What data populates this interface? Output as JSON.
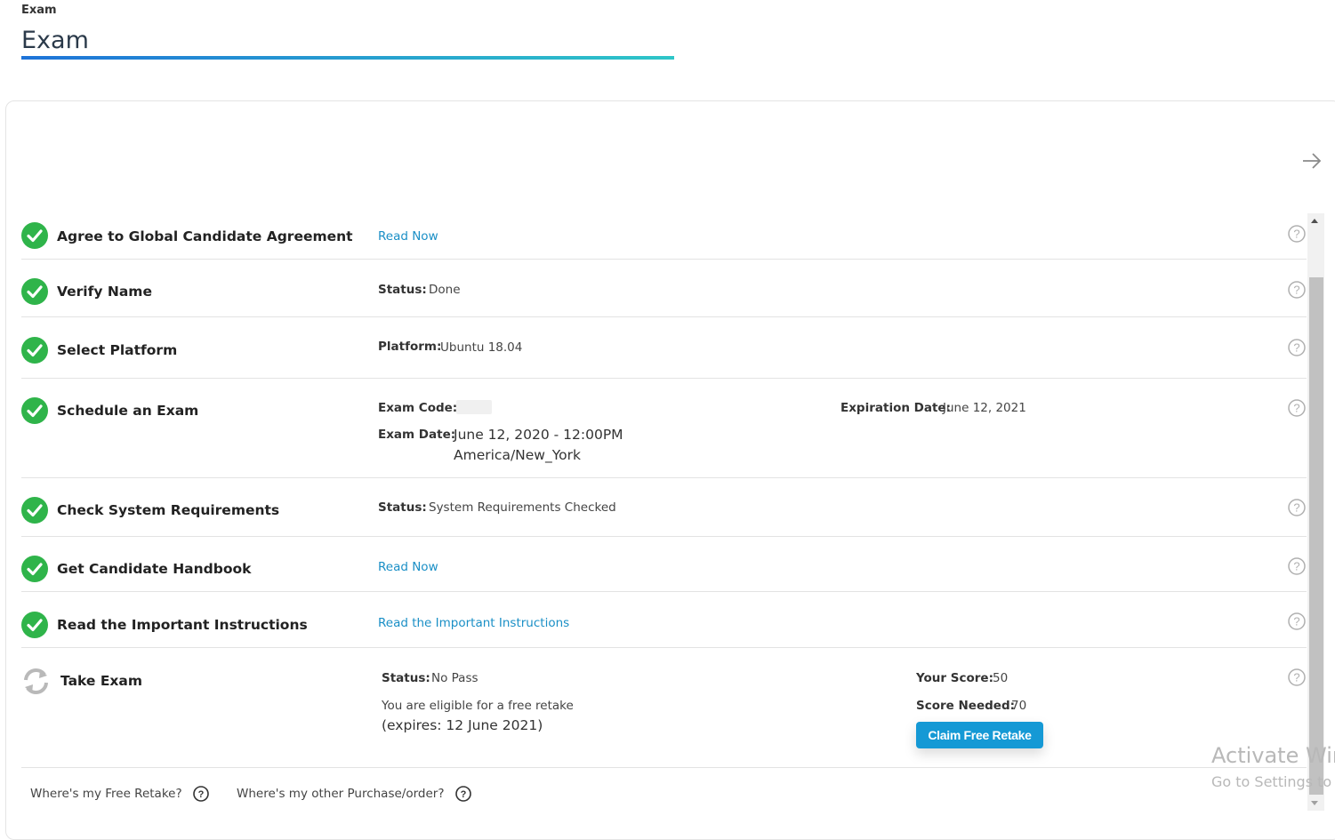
{
  "header": {
    "breadcrumb": "Exam",
    "title": "Exam"
  },
  "colors": {
    "accent": "#1a8fc6",
    "check": "#2fb44a",
    "button": "#1599d5"
  },
  "steps": {
    "agreement": {
      "title": "Agree to Global Candidate Agreement",
      "link": "Read Now"
    },
    "verify_name": {
      "title": "Verify Name",
      "status_label": "Status:",
      "status_value": "Done"
    },
    "platform": {
      "title": "Select Platform",
      "label": "Platform:",
      "value": "Ubuntu 18.04"
    },
    "schedule": {
      "title": "Schedule an Exam",
      "code_label": "Exam Code:",
      "date_label": "Exam Date:",
      "date_value": "June 12, 2020 - 12:00PM",
      "timezone": "America/New_York",
      "expiration_label": "Expiration Date:",
      "expiration_value": "June 12, 2021"
    },
    "system_check": {
      "title": "Check System Requirements",
      "status_label": "Status:",
      "status_value": "System Requirements Checked"
    },
    "handbook": {
      "title": "Get Candidate Handbook",
      "link": "Read Now"
    },
    "instructions": {
      "title": "Read the Important Instructions",
      "link": "Read the Important Instructions"
    },
    "take_exam": {
      "title": "Take Exam",
      "status_label": "Status:",
      "status_value": "No Pass",
      "retake_text": "You are eligible for a free retake",
      "retake_expiry": "(expires: 12 June 2021)",
      "score_label": "Your Score:",
      "score_value": "50",
      "needed_label": "Score Needed:",
      "needed_value": "70",
      "button": "Claim Free Retake"
    }
  },
  "footer": {
    "free_retake": "Where's my Free Retake?",
    "purchase": "Where's my other Purchase/order?"
  },
  "watermark": {
    "line1": "Activate Win",
    "line2": "Go to Settings to"
  }
}
